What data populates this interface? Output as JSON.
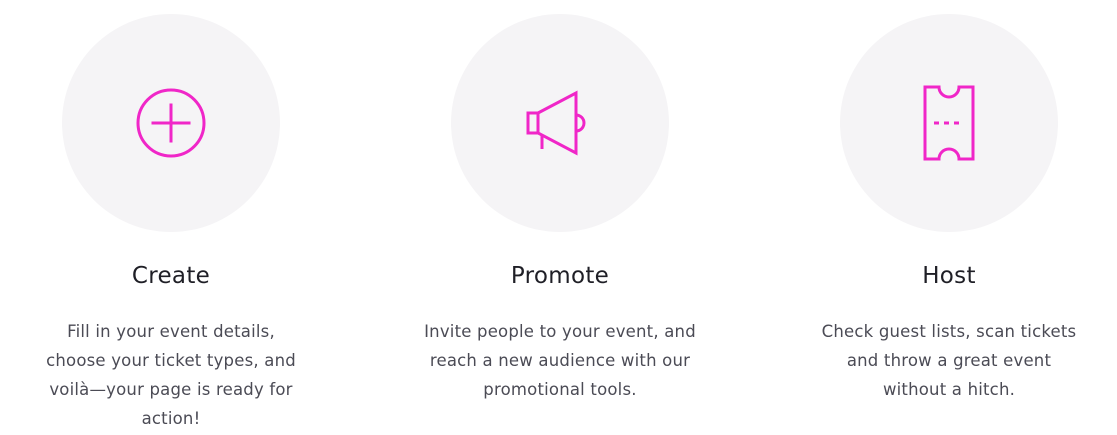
{
  "accent_color": "#f026c8",
  "features": [
    {
      "icon": "plus-circle-icon",
      "title": "Create",
      "description_lines": [
        "Fill in your event details,",
        "choose your ticket types, and",
        "voilà—your page is ready for",
        "action!"
      ]
    },
    {
      "icon": "megaphone-icon",
      "title": "Promote",
      "description_lines": [
        "Invite people to your event, and",
        "reach a new audience with our",
        "promotional tools."
      ]
    },
    {
      "icon": "ticket-icon",
      "title": "Host",
      "description_lines": [
        "Check guest lists, scan tickets",
        "and throw a great event",
        "without a hitch."
      ]
    }
  ]
}
